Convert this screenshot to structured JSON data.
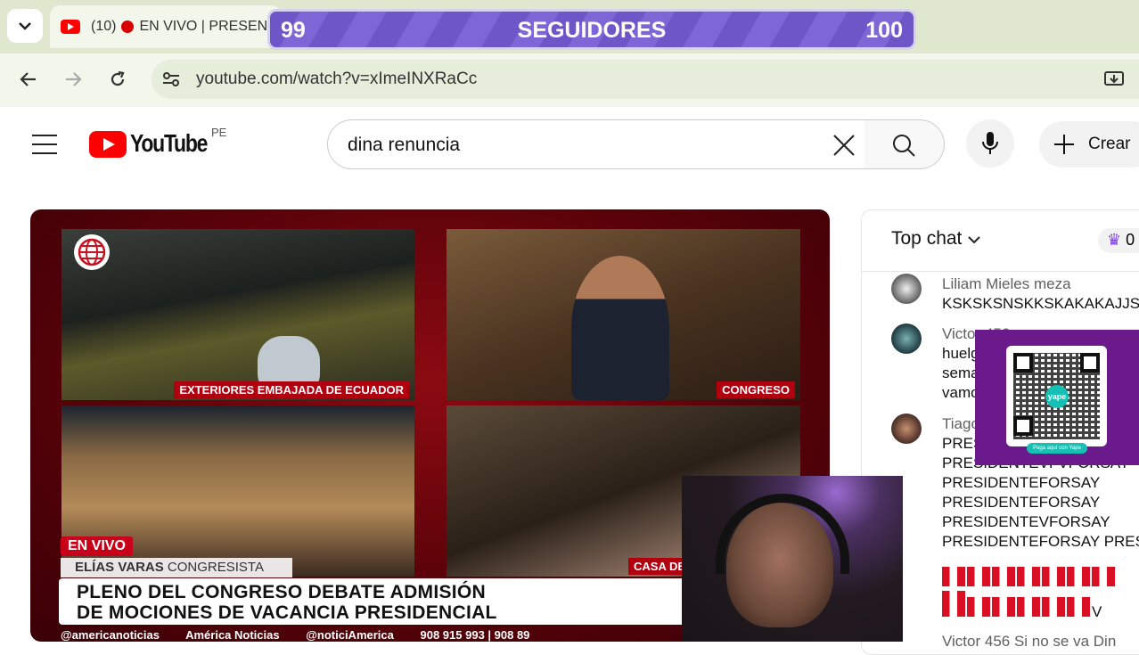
{
  "browser": {
    "tab_count": "(10)",
    "tab_title": "EN VIVO | PRESENT",
    "url": "youtube.com/watch?v=xImeINXRaCc"
  },
  "overlay": {
    "followers_current": "99",
    "followers_label": "SEGUIDORES",
    "followers_goal": "100"
  },
  "youtube": {
    "logo_text": "YouTube",
    "country": "PE",
    "search_query": "dina renuncia",
    "create_label": "Crear"
  },
  "video": {
    "captions": [
      "EXTERIORES EMBAJADA DE ECUADOR",
      "CONGRESO",
      "CASA DE"
    ],
    "live_badge": "EN VIVO",
    "speaker_name": "ELÍAS VARAS",
    "speaker_role": "CONGRESISTA",
    "headline_line1": "PLENO DEL CONGRESO DEBATE ADMISIÓN",
    "headline_line2": "DE MOCIONES DE VACANCIA PRESIDENCIAL",
    "social": [
      "@americanoticias",
      "América Noticias",
      "@noticiAmerica",
      "908 915 993  |  908 89"
    ]
  },
  "chat": {
    "title": "Top chat",
    "members_count": "0",
    "messages": [
      {
        "author": "Liliam Mieles meza",
        "lines": [
          "KSKSKSNSKKSKAKAKAJJS"
        ]
      },
      {
        "author": "Victor 456",
        "lines": [
          "huelg",
          "sema",
          "vamo"
        ]
      },
      {
        "author": "Tiago",
        "lines": [
          "PRESI",
          "PRESIDENTEVFVFORSAY",
          "PRESIDENTEFORSAY",
          "PRESIDENTEFORSAY",
          "PRESIDENTEVFORSAY",
          "PRESIDENTEFORSAY PRES"
        ]
      }
    ],
    "flag_suffix": "V",
    "partial_author": "Victor 456  Si no se va Din"
  },
  "qr": {
    "caption": "Paga aquí con Yape",
    "brand": "yape"
  }
}
